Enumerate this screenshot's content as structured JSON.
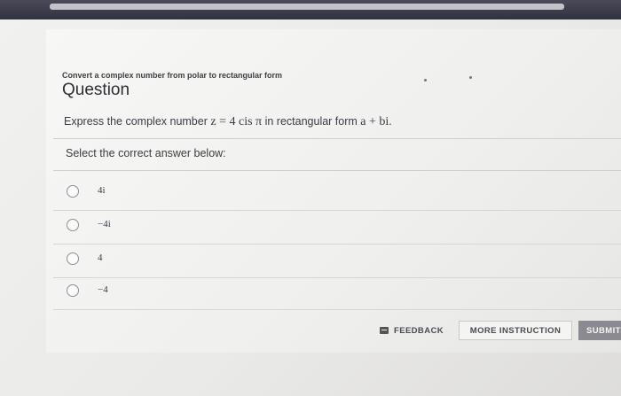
{
  "header": {
    "subtitle": "Convert a complex number from polar to rectangular form",
    "title": "Question"
  },
  "question": {
    "lead": "Express the complex number",
    "math_expr": "z = 4 cis π",
    "tail": "in rectangular form",
    "math_form": "a + bi",
    "end": "."
  },
  "answer": {
    "prompt": "Select the correct answer below:",
    "options": [
      {
        "label": "4i"
      },
      {
        "label": "−4i"
      },
      {
        "label": "4"
      },
      {
        "label": "−4"
      }
    ]
  },
  "footer": {
    "feedback_label": "FEEDBACK",
    "more_instruction_label": "MORE INSTRUCTION",
    "submit_label": "SUBMIT",
    "feedback_icon": "feedback-icon"
  }
}
